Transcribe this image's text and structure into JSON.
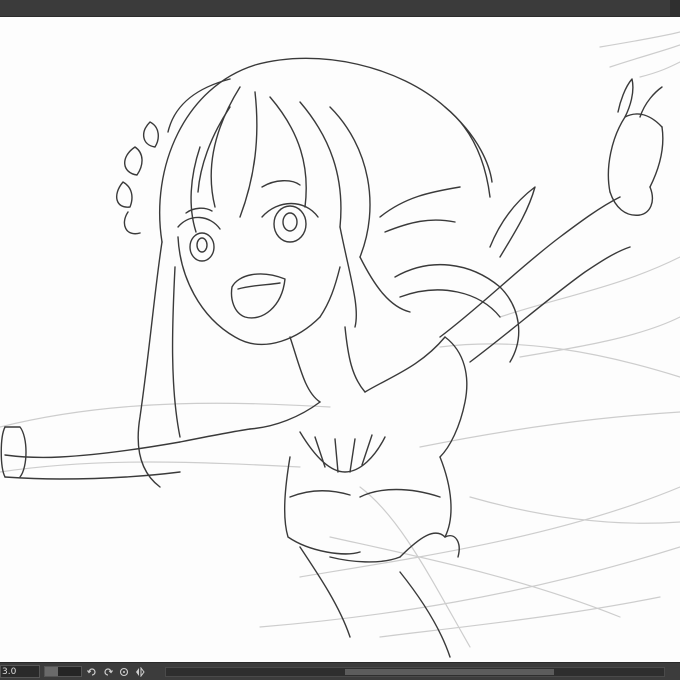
{
  "status_bar": {
    "zoom_value": "3.0",
    "zoom_level_fraction": 0.35,
    "scroll_position_fraction": 0.36,
    "scroll_visible_fraction": 0.42
  },
  "icons": {
    "undo": "undo-icon",
    "redo": "redo-icon",
    "reset_rotation": "reset-rotation-icon",
    "flip": "flip-horizontal-icon"
  },
  "colors": {
    "chrome": "#3b3b3b",
    "canvas": "#fdfdfd",
    "line_art": "#3a3a3a",
    "sketch": "#c8c8c8"
  }
}
